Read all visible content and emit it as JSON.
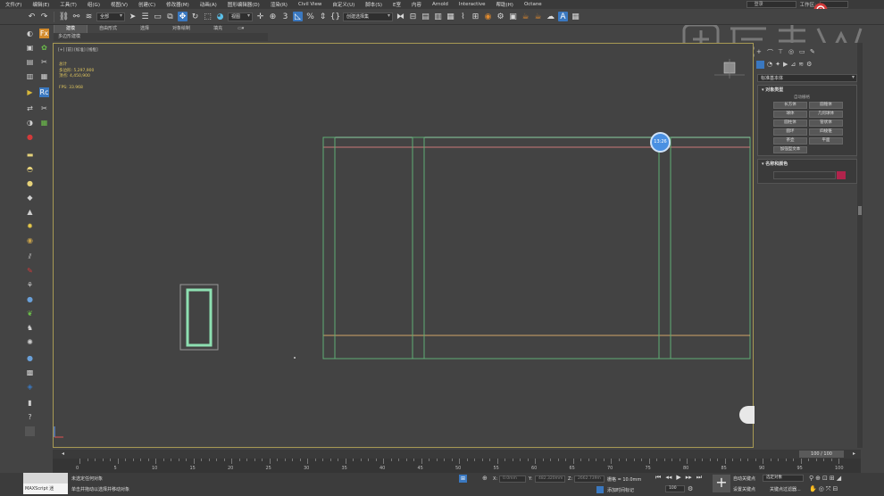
{
  "menu": {
    "items": [
      "文件(F)",
      "编辑(E)",
      "工具(T)",
      "组(G)",
      "视图(V)",
      "创建(C)",
      "修改器(M)",
      "动画(A)",
      "图形编辑器(D)",
      "渲染(R)",
      "Civil View",
      "自定义(U)",
      "脚本(S)",
      "E室",
      "内容",
      "Arnold",
      "Interactive",
      "帮助(H)",
      "Octane"
    ],
    "login": "登录",
    "workspace_label": "工作区:"
  },
  "toolbar": {
    "filter_dropdown": "全部",
    "view_dropdown": "视图",
    "selection_set": "创建选择集"
  },
  "ribbon": {
    "tabs": [
      "建模",
      "自由形式",
      "选择",
      "对象绘制",
      "填充"
    ],
    "active": "建模",
    "sub_label": "多边形建模"
  },
  "viewport": {
    "label": "[+] [前] [标准] [线框]",
    "stats_title": "总计",
    "polys_label": "多边形:",
    "polys_value": "5,297,900",
    "verts_label": "顶点:",
    "verts_value": "4,450,900",
    "fps_label": "FPS:",
    "fps_value": "33.968",
    "time_badge": "13:26"
  },
  "command_panel": {
    "dropdown": "标准基本体",
    "rollout_object_type": "对象类型",
    "autogrid_label": "自动栅格",
    "buttons": [
      "长方体",
      "圆锥体",
      "球体",
      "几何球体",
      "圆柱体",
      "管状体",
      "圆环",
      "四棱锥",
      "茶壶",
      "平面",
      "加强型文本"
    ],
    "rollout_name_color": "名称和颜色",
    "object_color": "#b0244c"
  },
  "timeline": {
    "frame_display": "100 / 100",
    "ticks": [
      0,
      5,
      10,
      15,
      20,
      25,
      30,
      35,
      40,
      45,
      50,
      55,
      60,
      65,
      70,
      75,
      80,
      85,
      90,
      95,
      100
    ]
  },
  "status": {
    "maxscript": "MAXScript 迷",
    "line1": "未选定任何对象",
    "line2": "单击并拖动以选择并移动对象",
    "x_label": "X:",
    "x_value": "0.0mm",
    "y_label": "Y:",
    "y_value": "482.320mm",
    "z_label": "Z:",
    "z_value": "2662.739m",
    "grid_label": "栅格 = 10.0mm",
    "add_time_tag": "添加时间标记",
    "auto_key": "自动关键点",
    "selected_object": "选定对象",
    "set_key": "设置关键点",
    "key_filter": "关键点过滤器...",
    "frame_value": "100"
  }
}
